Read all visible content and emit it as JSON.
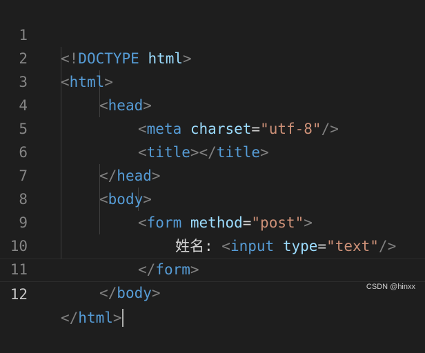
{
  "editor": {
    "language": "html",
    "active_line": 12,
    "line_numbers": [
      "1",
      "2",
      "3",
      "4",
      "5",
      "6",
      "7",
      "8",
      "9",
      "10",
      "11",
      "12"
    ],
    "lines": [
      {
        "tokens": [
          {
            "type": "punct",
            "text": "<!"
          },
          {
            "type": "tag",
            "text": "DOCTYPE"
          },
          {
            "type": "plain",
            "text": " "
          },
          {
            "type": "attr",
            "text": "html"
          },
          {
            "type": "punct",
            "text": ">"
          }
        ]
      },
      {
        "tokens": [
          {
            "type": "punct",
            "text": "<"
          },
          {
            "type": "tag",
            "text": "html"
          },
          {
            "type": "punct",
            "text": ">"
          }
        ]
      },
      {
        "tokens": [
          {
            "type": "punct",
            "text": "<"
          },
          {
            "type": "tag",
            "text": "head"
          },
          {
            "type": "punct",
            "text": ">"
          }
        ]
      },
      {
        "tokens": [
          {
            "type": "punct",
            "text": "<"
          },
          {
            "type": "tag",
            "text": "meta"
          },
          {
            "type": "plain",
            "text": " "
          },
          {
            "type": "attr",
            "text": "charset"
          },
          {
            "type": "plain",
            "text": "="
          },
          {
            "type": "string",
            "text": "\"utf-8\""
          },
          {
            "type": "punct",
            "text": "/>"
          }
        ]
      },
      {
        "tokens": [
          {
            "type": "punct",
            "text": "<"
          },
          {
            "type": "tag",
            "text": "title"
          },
          {
            "type": "punct",
            "text": "></"
          },
          {
            "type": "tag",
            "text": "title"
          },
          {
            "type": "punct",
            "text": ">"
          }
        ]
      },
      {
        "tokens": [
          {
            "type": "punct",
            "text": "</"
          },
          {
            "type": "tag",
            "text": "head"
          },
          {
            "type": "punct",
            "text": ">"
          }
        ]
      },
      {
        "tokens": [
          {
            "type": "punct",
            "text": "<"
          },
          {
            "type": "tag",
            "text": "body"
          },
          {
            "type": "punct",
            "text": ">"
          }
        ]
      },
      {
        "tokens": [
          {
            "type": "punct",
            "text": "<"
          },
          {
            "type": "tag",
            "text": "form"
          },
          {
            "type": "plain",
            "text": " "
          },
          {
            "type": "attr",
            "text": "method"
          },
          {
            "type": "plain",
            "text": "="
          },
          {
            "type": "string",
            "text": "\"post\""
          },
          {
            "type": "punct",
            "text": ">"
          }
        ]
      },
      {
        "tokens": [
          {
            "type": "plain",
            "text": "姓名: "
          },
          {
            "type": "punct",
            "text": "<"
          },
          {
            "type": "tag",
            "text": "input"
          },
          {
            "type": "plain",
            "text": " "
          },
          {
            "type": "attr",
            "text": "type"
          },
          {
            "type": "plain",
            "text": "="
          },
          {
            "type": "string",
            "text": "\"text\""
          },
          {
            "type": "punct",
            "text": "/>"
          }
        ]
      },
      {
        "tokens": [
          {
            "type": "punct",
            "text": "</"
          },
          {
            "type": "tag",
            "text": "form"
          },
          {
            "type": "punct",
            "text": ">"
          }
        ]
      },
      {
        "tokens": [
          {
            "type": "punct",
            "text": "</"
          },
          {
            "type": "tag",
            "text": "body"
          },
          {
            "type": "punct",
            "text": ">"
          }
        ]
      },
      {
        "tokens": [
          {
            "type": "punct",
            "text": "</"
          },
          {
            "type": "tag",
            "text": "html"
          },
          {
            "type": "punct",
            "text": ">"
          }
        ]
      }
    ]
  },
  "colors": {
    "background": "#1e1e1e",
    "punct": "#808080",
    "tag": "#569cd6",
    "attr": "#9cdcfe",
    "string": "#ce9178",
    "plain": "#d4d4d4",
    "line_number": "#858585"
  },
  "watermark": "CSDN @hinxx"
}
